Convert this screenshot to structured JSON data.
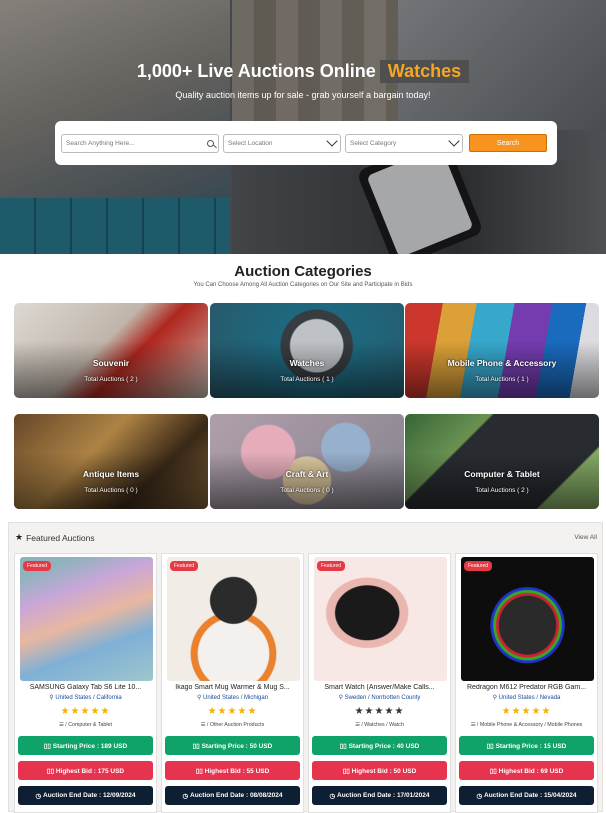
{
  "hero": {
    "title": "1,000+ Live Auctions Online",
    "rotating_word": "Watches",
    "subtitle": "Quality auction items up for sale - grab yourself a bargain today!",
    "search": {
      "placeholder": "Search Anything Here...",
      "location_placeholder": "Select Location",
      "category_placeholder": "Select Category",
      "button_label": "Search",
      "button_color": "#f7931e"
    }
  },
  "categories": {
    "title": "Auction Categories",
    "subtitle": "You Can Choose Among All Auction Categories on Our Site and Participate in Bids",
    "items": [
      {
        "name": "Souvenir",
        "count": "Total Auctions ( 2 )"
      },
      {
        "name": "Watches",
        "count": "Total Auctions ( 1 )"
      },
      {
        "name": "Mobile Phone & Accessory",
        "count": "Total Auctions ( 1 )"
      },
      {
        "name": "Antique Items",
        "count": "Total Auctions ( 0 )"
      },
      {
        "name": "Craft & Art",
        "count": "Total Auctions ( 0 )"
      },
      {
        "name": "Computer & Tablet",
        "count": "Total Auctions ( 2 )"
      }
    ]
  },
  "featured": {
    "title": "Featured Auctions",
    "view_all": "View All",
    "badge": "Featured",
    "cards": [
      {
        "title": "SAMSUNG Galaxy Tab S6 Lite 10...",
        "location": "United States / California",
        "rating": 5,
        "stars": "★★★★★",
        "category": "☰ / Computer & Tablet",
        "starting_price": "▯▯ Starting Price : 189 USD",
        "highest_bid": "▯▯ Highest Bid : 175 USD",
        "end_date": "Auction End Date : 12/09/2024"
      },
      {
        "title": "Ikago Smart Mug Warmer & Mug S...",
        "location": "United States / Michigan",
        "rating": 5,
        "stars": "★★★★★",
        "category": "☰ / Other Auction Products",
        "starting_price": "▯▯ Starting Price : 50 USD",
        "highest_bid": "▯▯ Highest Bid : 55 USD",
        "end_date": "Auction End Date : 08/08/2024"
      },
      {
        "title": "Smart Watch (Answer/Make Calls...",
        "location": "Sweden / Norrbotten County",
        "rating": 0,
        "stars": "★★★★★",
        "category": "☰ / Watches / Watch",
        "starting_price": "▯▯ Starting Price : 40 USD",
        "highest_bid": "▯▯ Highest Bid : 50 USD",
        "end_date": "Auction End Date : 17/01/2024"
      },
      {
        "title": "Redragon M612 Predator RGB Gam...",
        "location": "United States / Nevada",
        "rating": 5,
        "stars": "★★★★★",
        "category": "☰ / Mobile Phone & Accessory / Mobile Phones",
        "starting_price": "▯▯ Starting Price : 15 USD",
        "highest_bid": "▯▯ Highest Bid : 69 USD",
        "end_date": "Auction End Date : 15/04/2024"
      }
    ]
  },
  "colors": {
    "accent": "#f7931e",
    "starting_price": "#0fa36a",
    "highest_bid": "#e6344f",
    "end_date": "#0f1f33",
    "badge": "#e63946",
    "star_active": "#f5b301",
    "star_inactive": "#333333"
  }
}
